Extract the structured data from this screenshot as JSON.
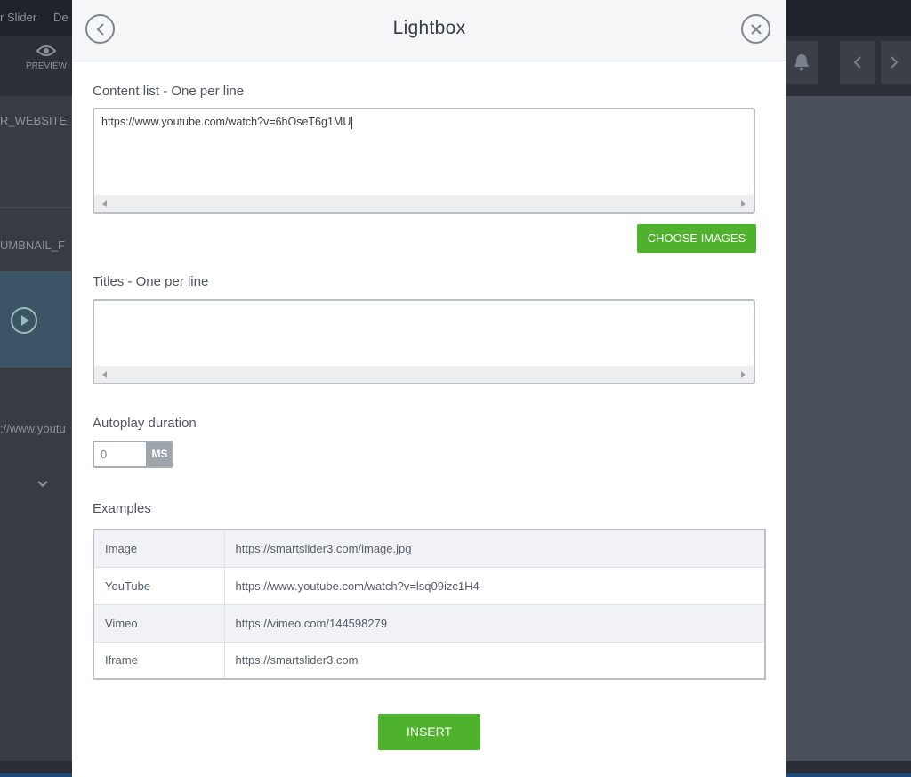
{
  "background": {
    "top_text_1": "r Slider",
    "top_text_2": "De",
    "preview_label": "PREVIEW",
    "left_text_1": "R_WEBSITE",
    "left_text_2": "UMBNAIL_F",
    "left_text_3": "://www.youtu"
  },
  "modal": {
    "title": "Lightbox",
    "content_list": {
      "label": "Content list - One per line",
      "value": "https://www.youtube.com/watch?v=6hOseT6g1MU"
    },
    "choose_images_label": "CHOOSE IMAGES",
    "titles": {
      "label": "Titles - One per line",
      "value": ""
    },
    "autoplay": {
      "label": "Autoplay duration",
      "value": "0",
      "unit": "MS"
    },
    "examples": {
      "label": "Examples",
      "rows": [
        {
          "type": "Image",
          "url": "https://smartslider3.com/image.jpg"
        },
        {
          "type": "YouTube",
          "url": "https://www.youtube.com/watch?v=lsq09izc1H4"
        },
        {
          "type": "Vimeo",
          "url": "https://vimeo.com/144598279"
        },
        {
          "type": "Iframe",
          "url": "https://smartslider3.com"
        }
      ]
    },
    "insert_label": "INSERT"
  }
}
